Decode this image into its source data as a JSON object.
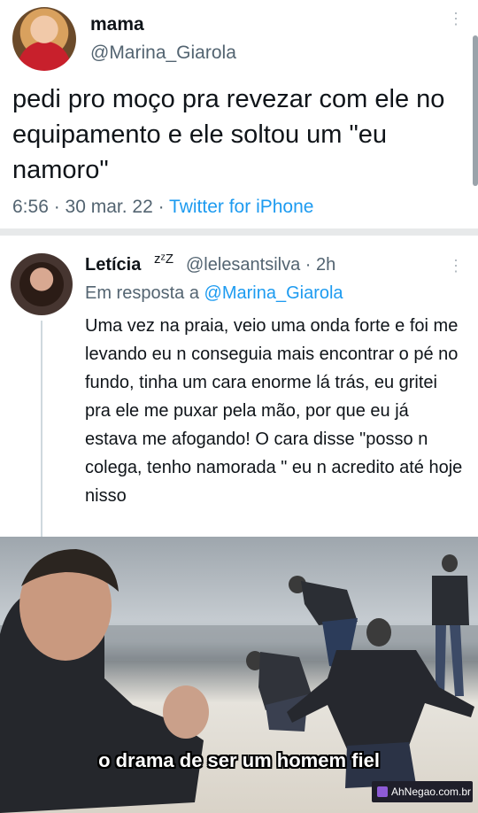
{
  "tweet": {
    "display_name": "mama",
    "handle": "@Marina_Giarola",
    "more": "⋮",
    "text": "pedi pro moço pra revezar com ele no equipamento e ele soltou um \"eu namoro\"",
    "time_date": "6:56 · 30 mar. 22 · ",
    "source": "Twitter for iPhone"
  },
  "reply": {
    "display_name": "Letícia",
    "name_emoji": "zᶻZ",
    "handle_time": "@lelesantsilva · 2h",
    "more": "⋮",
    "reply_prefix": "Em resposta a ",
    "reply_mention": "@Marina_Giarola",
    "text": "Uma vez na praia, veio uma onda forte e foi me levando eu n conseguia mais encontrar o pé no fundo, tinha um cara enorme lá trás, eu gritei pra ele me puxar pela mão, por que eu já estava me afogando! O cara disse \"posso n colega, tenho namorada \" eu n acredito até hoje nisso"
  },
  "meme": {
    "caption": "o drama de ser um homem fiel",
    "watermark": "AhNegao.com.br"
  }
}
